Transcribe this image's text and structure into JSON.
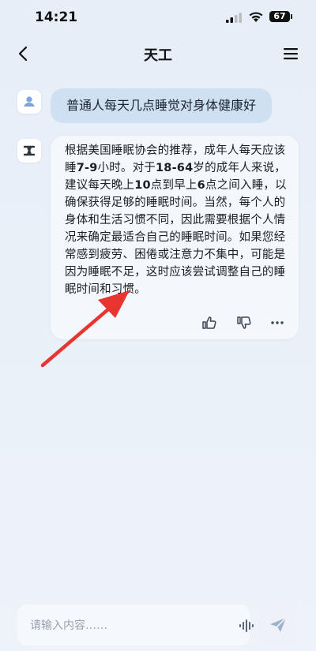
{
  "status_bar": {
    "time": "14:21",
    "battery": "67"
  },
  "nav": {
    "title": "天工",
    "back_icon": "chevron-left-icon",
    "menu_icon": "hamburger-menu-icon"
  },
  "conversation": {
    "user_message": "普通人每天几点睡觉对身体健康好",
    "ai_message": {
      "segments": [
        {
          "text": "根据美国睡眠协会的推荐，成年人每天应该睡",
          "bold": false
        },
        {
          "text": "7-9",
          "bold": true
        },
        {
          "text": "小时。对于",
          "bold": false
        },
        {
          "text": "18-64",
          "bold": true
        },
        {
          "text": "岁的成年人来说，建议每天晚上",
          "bold": false
        },
        {
          "text": "10",
          "bold": true
        },
        {
          "text": "点到早上",
          "bold": false
        },
        {
          "text": "6",
          "bold": true
        },
        {
          "text": "点之间入睡，以确保获得足够的睡眠时间。当然，每个人的身体和生活习惯不同，因此需要根据个人情况来确定最适合自己的睡眠时间。如果您经常感到疲劳、困倦或注意力不集中，可能是因为睡眠不足，这时应该尝试调整自己的睡眠时间和习惯。",
          "bold": false
        }
      ]
    },
    "actions": {
      "like_icon": "thumbs-up-icon",
      "dislike_icon": "thumbs-down-icon",
      "more_icon": "more-dots-icon"
    }
  },
  "composer": {
    "placeholder": "请输入内容……",
    "voice_icon": "voice-wave-icon",
    "send_icon": "send-icon"
  },
  "colors": {
    "user_bubble": "#cfe0f3",
    "ai_bubble": "#f4f7fb",
    "annotation_arrow": "#e8352f",
    "background": "#e7eef7"
  }
}
